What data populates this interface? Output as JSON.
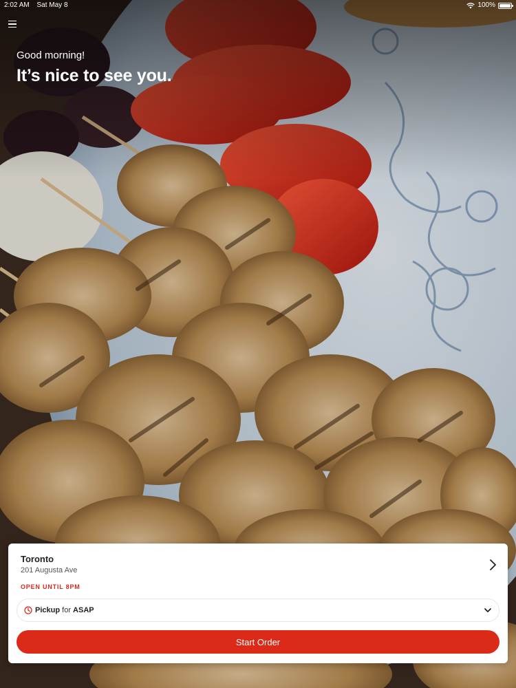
{
  "status_bar": {
    "time": "2:02 AM",
    "date": "Sat May 8",
    "battery": "100%"
  },
  "header": {
    "greeting": "Good morning!",
    "headline": "It’s nice to see you."
  },
  "location": {
    "name": "Toronto",
    "address": "201 Augusta Ave",
    "status": "OPEN UNTIL 8PM"
  },
  "order_mode": {
    "mode": "Pickup",
    "connector": "for",
    "time": "ASAP"
  },
  "actions": {
    "start_order_label": "Start Order"
  },
  "theme": {
    "accent": "#db2a17",
    "status_red": "#d9291c"
  },
  "icons": [
    "menu-icon",
    "wifi-icon",
    "battery-icon",
    "chevron-right-icon",
    "clock-icon",
    "chevron-down-icon"
  ]
}
